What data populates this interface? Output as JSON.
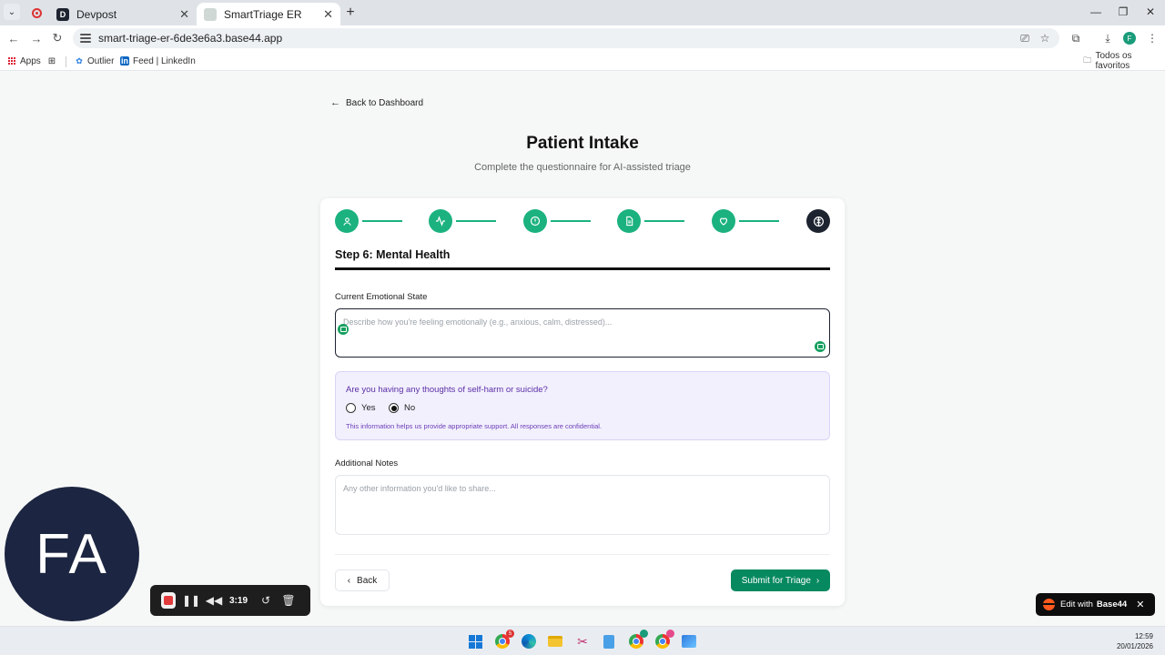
{
  "browser": {
    "tabs": [
      {
        "title": "Devpost",
        "favicon_letter": "D"
      },
      {
        "title": "SmartTriage ER"
      }
    ],
    "url": "smart-triage-er-6de3e6a3.base44.app",
    "profile_initial": "F",
    "bookmarks": [
      {
        "label": "Apps",
        "icon": "apps-grid-icon"
      },
      {
        "label": "",
        "icon": "tab-groups-icon"
      },
      {
        "label": "Outlier",
        "icon": "outlier-icon"
      },
      {
        "label": "Feed | LinkedIn",
        "icon": "linkedin-icon"
      }
    ],
    "all_bookmarks_label": "Todos os favoritos"
  },
  "page": {
    "back_link": "Back to Dashboard",
    "title": "Patient Intake",
    "subtitle": "Complete the questionnaire for AI-assisted triage",
    "steps": [
      {
        "icon": "user-icon",
        "state": "complete"
      },
      {
        "icon": "activity-icon",
        "state": "complete"
      },
      {
        "icon": "alert-circle-icon",
        "state": "complete"
      },
      {
        "icon": "document-icon",
        "state": "complete"
      },
      {
        "icon": "heart-icon",
        "state": "complete"
      },
      {
        "icon": "brain-icon",
        "state": "active"
      }
    ],
    "colors": {
      "step_complete": "#1bb27f",
      "step_active": "#1d2430",
      "submit": "#07895f",
      "alert_text": "#5b2ea6"
    },
    "step_title": "Step 6: Mental Health",
    "emotional_state": {
      "label": "Current Emotional State",
      "placeholder": "Describe how you're feeling emotionally (e.g., anxious, calm, distressed)...",
      "value": ""
    },
    "self_harm": {
      "question": "Are you having any thoughts of self-harm or suicide?",
      "options": [
        "Yes",
        "No"
      ],
      "selected": "No",
      "note": "This information helps us provide appropriate support. All responses are confidential."
    },
    "additional_notes": {
      "label": "Additional Notes",
      "placeholder": "Any other information you'd like to share...",
      "value": ""
    },
    "back_button": "Back",
    "submit_button": "Submit for Triage"
  },
  "overlay": {
    "avatar_initials": "FA",
    "recorder_time": "3:19",
    "badge_prefix": "Edit with",
    "badge_brand": "Base44"
  },
  "taskbar": {
    "time": "12:59",
    "date": "20/01/2026",
    "chrome_badge": "5"
  }
}
